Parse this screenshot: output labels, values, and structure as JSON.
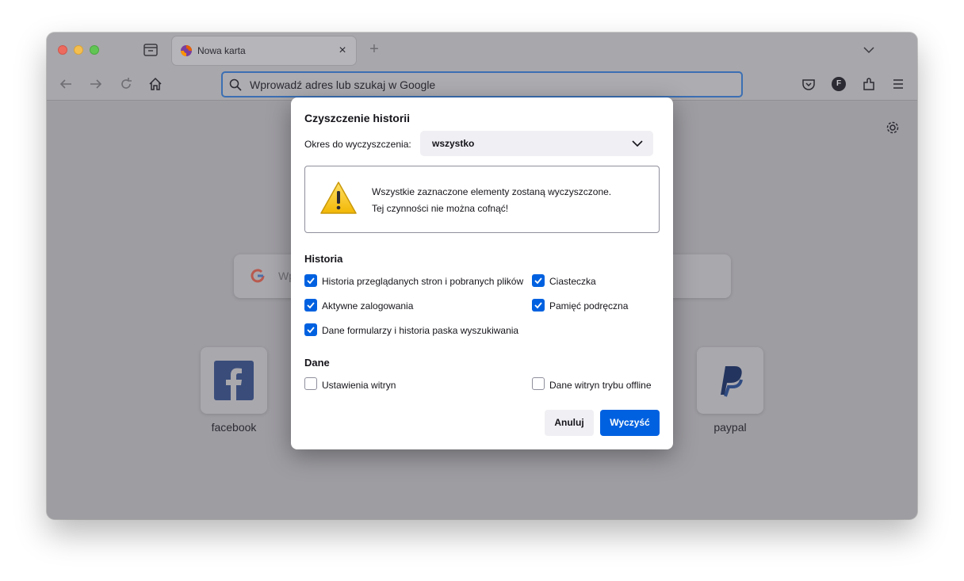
{
  "browser": {
    "tab": {
      "title": "Nowa karta",
      "close_glyph": "×"
    },
    "new_tab_glyph": "+",
    "urlbar": {
      "placeholder": "Wprowadź adres lub szukaj w Google"
    },
    "account_initial": "F",
    "icons": [
      "tab-list-icon",
      "firefox-icon",
      "close-icon",
      "plus-icon",
      "chevron-down-icon",
      "back-icon",
      "forward-icon",
      "reload-icon",
      "home-icon",
      "search-icon",
      "pocket-icon",
      "extensions-icon",
      "menu-icon",
      "gear-icon",
      "google-icon",
      "facebook-icon",
      "paypal-icon",
      "warning-icon",
      "checkmark-icon"
    ]
  },
  "newtab": {
    "search_placeholder": "Wp",
    "shortcuts": [
      {
        "label": "facebook"
      },
      {
        "label": "paypal"
      }
    ]
  },
  "dialog": {
    "title": "Czyszczenie historii",
    "range_label": "Okres do wyczyszczenia:",
    "range_value": "wszystko",
    "warning_line1": "Wszystkie zaznaczone elementy zostaną wyczyszczone.",
    "warning_line2": "Tej czynności nie można cofnąć!",
    "history_title": "Historia",
    "history_items": [
      {
        "label": "Historia przeglądanych stron i pobranych plików",
        "checked": true
      },
      {
        "label": "Ciasteczka",
        "checked": true
      },
      {
        "label": "Aktywne zalogowania",
        "checked": true
      },
      {
        "label": "Pamięć podręczna",
        "checked": true
      },
      {
        "label": "Dane formularzy i historia paska wyszukiwania",
        "checked": true
      }
    ],
    "data_title": "Dane",
    "data_items": [
      {
        "label": "Ustawienia witryn",
        "checked": false
      },
      {
        "label": "Dane witryn trybu offline",
        "checked": false
      }
    ],
    "cancel_label": "Anuluj",
    "clear_label": "Wyczyść"
  },
  "colors": {
    "accent": "#0061e0",
    "urlbar_focus": "#3b6fb3"
  }
}
